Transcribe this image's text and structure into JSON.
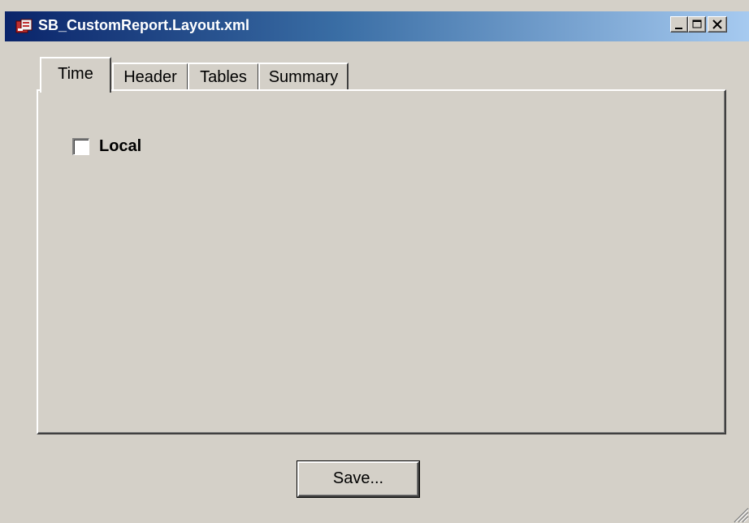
{
  "window": {
    "title": "SB_CustomReport.Layout.xml",
    "icon": "app-icon",
    "controls": [
      "minimize-icon",
      "maximize-icon",
      "close-icon"
    ]
  },
  "tabs": [
    {
      "label": "Time",
      "active": true
    },
    {
      "label": "Header",
      "active": false
    },
    {
      "label": "Tables",
      "active": false
    },
    {
      "label": "Summary",
      "active": false
    }
  ],
  "panel": {
    "local_checkbox": {
      "label": "Local",
      "checked": false
    }
  },
  "actions": {
    "save_label": "Save..."
  },
  "colors": {
    "face": "#d4d0c8",
    "titlebar_start": "#0a246a",
    "titlebar_end": "#a6caf0",
    "title_text": "#ffffff"
  }
}
